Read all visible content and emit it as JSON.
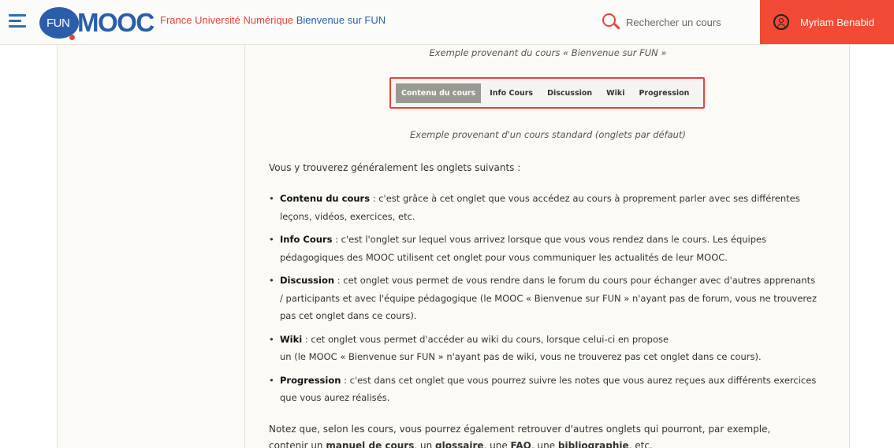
{
  "header": {
    "logo_fun": "FUN",
    "logo_mooc": "MOOC",
    "site_name": "France Université Numérique",
    "welcome": "Bienvenue sur FUN",
    "search_label": "Rechercher un cours",
    "user_name": "Myriam Benabid",
    "colors": {
      "brand_blue": "#2a5eaa",
      "brand_red": "#e8433a",
      "user_bg": "#f24a34"
    }
  },
  "content": {
    "caption_top": "Exemple provenant du cours « Bienvenue sur FUN »",
    "tabs": [
      {
        "label": "Contenu du cours",
        "active": true
      },
      {
        "label": "Info Cours"
      },
      {
        "label": "Discussion"
      },
      {
        "label": "Wiki"
      },
      {
        "label": "Progression"
      }
    ],
    "caption_tabs": "Exemple provenant d'un cours standard (onglets par défaut)",
    "intro": "Vous y trouverez généralement les onglets suivants :",
    "items": [
      {
        "term": "Contenu du cours",
        "text": " : c'est grâce à cet onglet que vous accédez au cours à proprement parler avec ses différentes leçons, vidéos, exercices, etc."
      },
      {
        "term": "Info Cours",
        "text": " : c'est l'onglet sur lequel vous arrivez lorsque que vous vous rendez dans le cours. Les équipes pédagogiques des MOOC utilisent cet onglet pour vous communiquer les actualités de leur MOOC."
      },
      {
        "term": "Discussion",
        "text": " : cet onglet vous permet de vous rendre dans le forum du cours pour échanger avec d'autres apprenants / participants et avec l'équipe pédagogique (le MOOC « Bienvenue sur FUN » n'ayant pas de forum, vous ne trouverez pas cet onglet dans ce cours)."
      },
      {
        "term": "Wiki",
        "text_1": " : cet onglet vous permet d'accéder au wiki du cours, lorsque celui-ci en propose",
        "text_2": "un (le MOOC « Bienvenue sur FUN » n'ayant pas de wiki, vous ne trouverez pas cet onglet dans ce cours)."
      },
      {
        "term": "Progression",
        "text": " : c'est dans cet onglet que vous pourrez suivre les notes que vous aurez reçues aux différents exercices que vous aurez réalisés."
      }
    ],
    "outro_1": "Notez que, selon les cours, vous pourrez également retrouver d'autres onglets qui pourront, par exemple,",
    "outro_2_a": "contenir un ",
    "outro_2_b": "manuel de cours",
    "outro_2_c": ", un ",
    "outro_2_d": "glossaire",
    "outro_2_e": ", une ",
    "outro_2_f": "FAQ",
    "outro_2_g": ", une ",
    "outro_2_h": "bibliographie",
    "outro_2_i": ", etc."
  }
}
